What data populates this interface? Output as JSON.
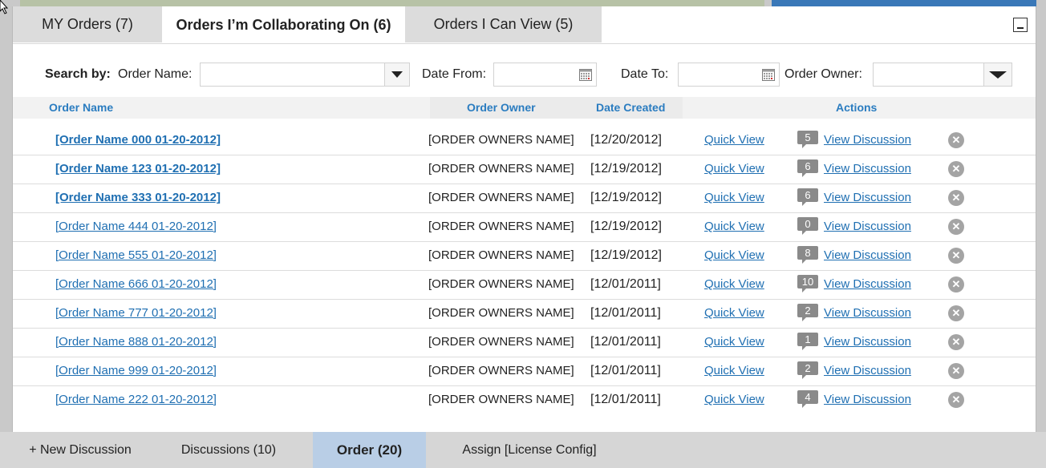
{
  "tabs": [
    {
      "label": "MY Orders  (7)"
    },
    {
      "label": "Orders I’m Collaborating On (6)"
    },
    {
      "label": "Orders I Can View (5)"
    }
  ],
  "search": {
    "search_by_label": "Search by:",
    "order_name_label": "Order Name:",
    "date_from_label": "Date From:",
    "date_to_label": "Date To:",
    "order_owner_label": "Order Owner:",
    "order_name_value": "",
    "date_from_value": "",
    "date_to_value": "",
    "order_owner_value": ""
  },
  "table": {
    "headers": {
      "order_name": "Order Name",
      "order_owner": "Order Owner",
      "date_created": "Date Created",
      "actions": "Actions"
    },
    "rows": [
      {
        "name": "[Order Name 000 01-20-2012]",
        "owner": "[ORDER OWNERS NAME]",
        "date": "[12/20/2012]",
        "quick_view": "Quick View",
        "count": "5",
        "view_discussion": "View Discussion",
        "bold": true
      },
      {
        "name": "[Order Name 123 01-20-2012]",
        "owner": "[ORDER OWNERS NAME]",
        "date": "[12/19/2012]",
        "quick_view": "Quick View",
        "count": "6",
        "view_discussion": "View Discussion",
        "bold": true
      },
      {
        "name": "[Order Name 333 01-20-2012]",
        "owner": "[ORDER OWNERS NAME]",
        "date": "[12/19/2012]",
        "quick_view": "Quick View",
        "count": "6",
        "view_discussion": "View Discussion",
        "bold": true
      },
      {
        "name": "[Order Name 444 01-20-2012]",
        "owner": "[ORDER OWNERS NAME]",
        "date": "[12/19/2012]",
        "quick_view": "Quick View",
        "count": "0",
        "view_discussion": "View Discussion",
        "bold": false
      },
      {
        "name": "[Order Name 555 01-20-2012]",
        "owner": "[ORDER OWNERS NAME]",
        "date": "[12/19/2012]",
        "quick_view": "Quick View",
        "count": "8",
        "view_discussion": "View Discussion",
        "bold": false
      },
      {
        "name": "[Order Name 666 01-20-2012]",
        "owner": "[ORDER OWNERS NAME]",
        "date": "[12/01/2011]",
        "quick_view": "Quick View",
        "count": "10",
        "view_discussion": "View Discussion",
        "bold": false
      },
      {
        "name": "[Order Name 777 01-20-2012]",
        "owner": "[ORDER OWNERS NAME]",
        "date": "[12/01/2011]",
        "quick_view": "Quick View",
        "count": "2",
        "view_discussion": "View Discussion",
        "bold": false
      },
      {
        "name": "[Order Name 888 01-20-2012]",
        "owner": "[ORDER OWNERS NAME]",
        "date": "[12/01/2011]",
        "quick_view": "Quick View",
        "count": "1",
        "view_discussion": "View Discussion",
        "bold": false
      },
      {
        "name": "[Order Name 999 01-20-2012]",
        "owner": "[ORDER OWNERS NAME]",
        "date": "[12/01/2011]",
        "quick_view": "Quick View",
        "count": "2",
        "view_discussion": "View Discussion",
        "bold": false
      },
      {
        "name": "[Order Name 222 01-20-2012]",
        "owner": "[ORDER OWNERS NAME]",
        "date": "[12/01/2011]",
        "quick_view": "Quick View",
        "count": "4",
        "view_discussion": "View Discussion",
        "bold": false
      }
    ]
  },
  "bottom_tabs": [
    {
      "label": "+ New Discussion"
    },
    {
      "label": "Discussions (10)"
    },
    {
      "label": "Order (20)"
    },
    {
      "label": "Assign [License Config]"
    }
  ],
  "icons": {
    "minimize": "minimize-icon",
    "calendar": "calendar-icon",
    "dropdown": "chevron-down-icon",
    "remove": "close-circle-icon",
    "comment": "comment-bubble-icon",
    "cursor": "mouse-pointer-icon"
  },
  "colors": {
    "link": "#1f6fb2",
    "header_text": "#2a7cc0",
    "active_bottom_tab": "#b9cee6",
    "badge": "#8a8a8a"
  }
}
